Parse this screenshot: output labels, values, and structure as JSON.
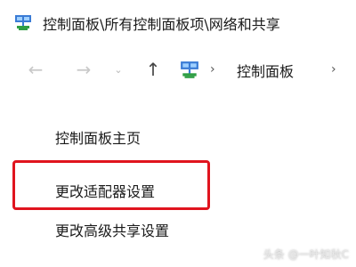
{
  "window": {
    "title": "控制面板\\所有控制面板项\\网络和共享"
  },
  "navigation": {
    "back_icon": "←",
    "forward_icon": "→",
    "recent_icon": "⌄",
    "up_icon": "↑",
    "breadcrumb_separator": "›",
    "breadcrumb": [
      "控制面板"
    ]
  },
  "sidebar": {
    "items": [
      {
        "label": "控制面板主页"
      },
      {
        "label": "更改适配器设置"
      },
      {
        "label": "更改高级共享设置"
      }
    ]
  },
  "highlight": {
    "color": "#e0141e"
  },
  "watermark": {
    "text": "头条 @一叶知秋C"
  },
  "colors": {
    "disabled_arrow": "#c8c8c8",
    "text": "#1a1a1a"
  }
}
